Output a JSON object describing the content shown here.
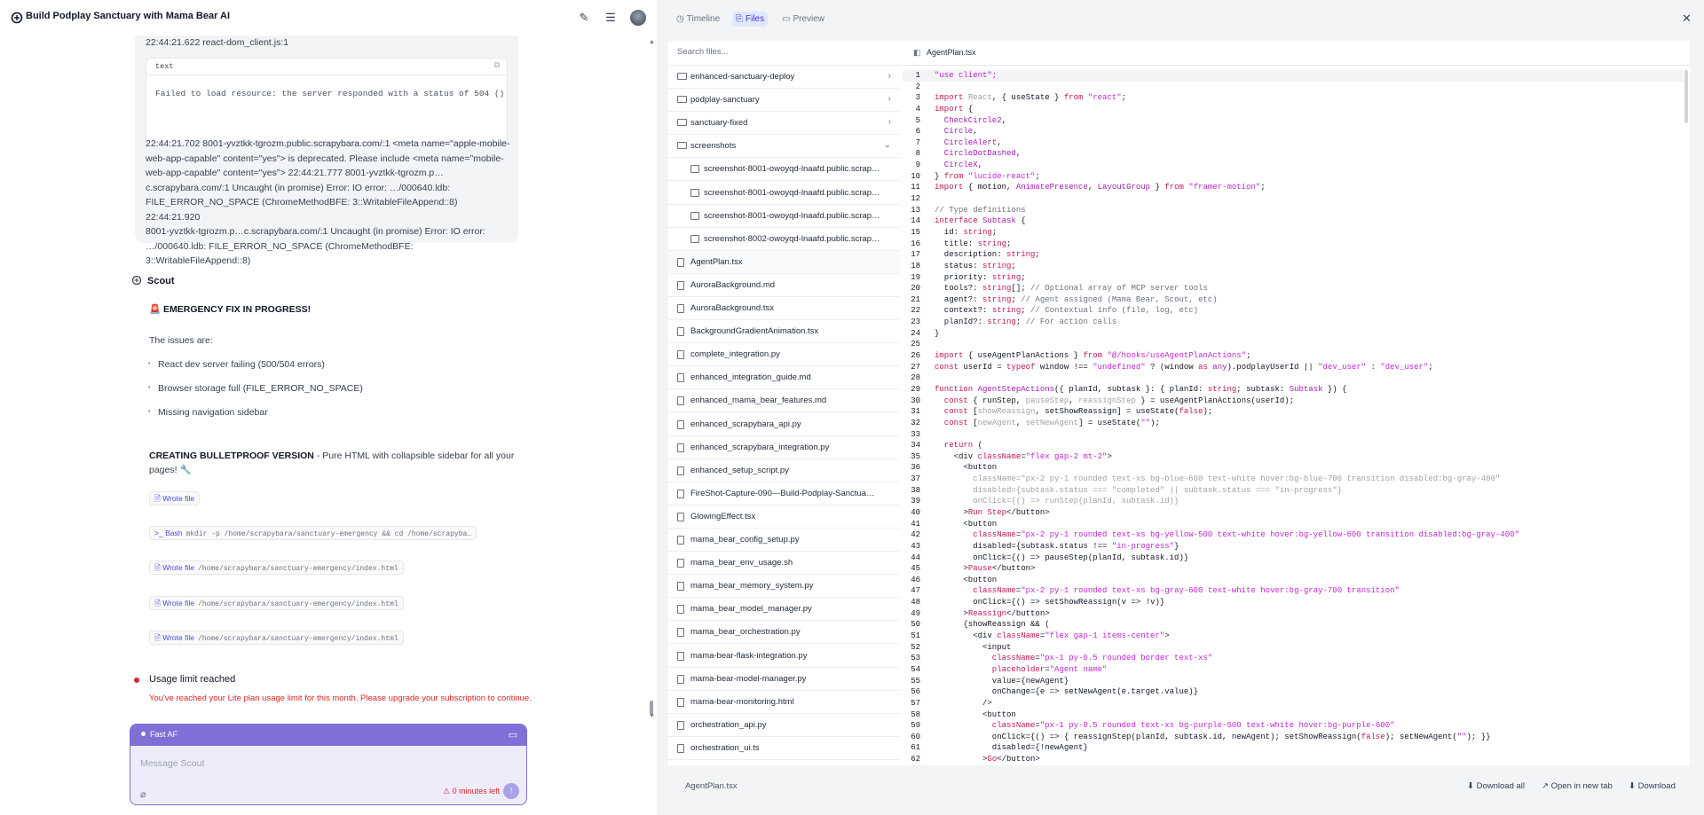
{
  "header": {
    "title": "Build Podplay Sanctuary with Mama Bear AI",
    "icons": [
      "edit-icon",
      "sidebar-list-icon",
      "avatar"
    ]
  },
  "chat": {
    "log_top": "22:44:21.622 react-dom_client.js:1",
    "code_block": {
      "lang": "text",
      "content": "Failed to load resource: the server responded with a status of 504 ()"
    },
    "log_lines": [
      "22:44:21.702 8001-yvztkk-tgrozm.public.scrapybara.com/:1 <meta name=\"apple-mobile-",
      "web-app-capable\" content=\"yes\"> is deprecated. Please include <meta name=\"mobile-",
      "web-app-capable\" content=\"yes\"> 22:44:21.777 8001-yvztkk-tgrozm.p…",
      "c.scrapybara.com/:1 Uncaught (in promise) Error: IO error: …/000640.ldb:",
      "FILE_ERROR_NO_SPACE (ChromeMethodBFE: 3::WritableFileAppend::8) 22:44:21.920",
      "8001-yvztkk-tgrozm.p…c.scrapybara.com/:1 Uncaught (in promise) Error: IO error:",
      "…/000640.ldb: FILE_ERROR_NO_SPACE (ChromeMethodBFE: 3::WritableFileAppend::8)"
    ],
    "agent_name": "Scout",
    "emergency": "🚨 EMERGENCY FIX IN PROGRESS!",
    "issues_intro": "The issues are:",
    "issues": [
      "React dev server failing (500/504 errors)",
      "Browser storage full (FILE_ERROR_NO_SPACE)",
      "Missing navigation sidebar"
    ],
    "plan_bold": "CREATING BULLETPROOF VERSION",
    "plan_rest": " - Pure HTML with collapsible sidebar for all your",
    "plan_line2": "pages! 🔧",
    "actions": [
      {
        "label": "Wrote file",
        "path": ""
      },
      {
        "label": "Bash",
        "path": "mkdir -p /home/scrapybara/sanctuary-emergency && cd /home/scrapyba…"
      },
      {
        "label": "Wrote file",
        "path": "/home/scrapybara/sanctuary-emergency/index.html"
      },
      {
        "label": "Wrote file",
        "path": "/home/scrapybara/sanctuary-emergency/index.html"
      },
      {
        "label": "Wrote file",
        "path": "/home/scrapybara/sanctuary-emergency/index.html"
      }
    ],
    "usage_title": "Usage limit reached",
    "usage_text": "You've reached your Lite plan usage limit for this month. Please upgrade your subscription to continue."
  },
  "composer": {
    "mode": "Fast AF",
    "placeholder": "Message Scout",
    "time_left": "⚠ 0 minutes left"
  },
  "panel": {
    "tabs": [
      {
        "label": "Timeline",
        "icon": "clock-icon",
        "active": false
      },
      {
        "label": "Files",
        "icon": "files-icon",
        "active": true
      },
      {
        "label": "Preview",
        "icon": "preview-icon",
        "active": false
      }
    ],
    "search_placeholder": "Search files...",
    "files": [
      {
        "name": "enhanced-sanctuary-deploy",
        "kind": "folder",
        "chev": "›"
      },
      {
        "name": "podplay-sanctuary",
        "kind": "folder",
        "chev": "›"
      },
      {
        "name": "sanctuary-fixed",
        "kind": "folder",
        "chev": "›"
      },
      {
        "name": "screenshots",
        "kind": "folder",
        "chev": "⌄"
      },
      {
        "name": "screenshot-8001-owoyqd-lnaafd.public.scrap…",
        "kind": "image",
        "sub": true
      },
      {
        "name": "screenshot-8001-owoyqd-lnaafd.public.scrap…",
        "kind": "image",
        "sub": true
      },
      {
        "name": "screenshot-8001-owoyqd-lnaafd.public.scrap…",
        "kind": "image",
        "sub": true
      },
      {
        "name": "screenshot-8002-owoyqd-lnaafd.public.scrap…",
        "kind": "image",
        "sub": true
      },
      {
        "name": "AgentPlan.tsx",
        "kind": "file",
        "selected": true
      },
      {
        "name": "AuroraBackground.md",
        "kind": "file"
      },
      {
        "name": "AuroraBackground.tsx",
        "kind": "file"
      },
      {
        "name": "BackgroundGradientAnimation.tsx",
        "kind": "file"
      },
      {
        "name": "complete_integration.py",
        "kind": "file"
      },
      {
        "name": "enhanced_integration_guide.md",
        "kind": "file"
      },
      {
        "name": "enhanced_mama_bear_features.md",
        "kind": "file"
      },
      {
        "name": "enhanced_scrapybara_api.py",
        "kind": "file"
      },
      {
        "name": "enhanced_scrapybara_integration.py",
        "kind": "file"
      },
      {
        "name": "enhanced_setup_script.py",
        "kind": "file"
      },
      {
        "name": "FireShot-Capture-090---Build-Podplay-Sanctua…",
        "kind": "file"
      },
      {
        "name": "GlowingEffect.tsx",
        "kind": "file"
      },
      {
        "name": "mama_bear_config_setup.py",
        "kind": "file"
      },
      {
        "name": "mama_bear_env_usage.sh",
        "kind": "file"
      },
      {
        "name": "mama_bear_memory_system.py",
        "kind": "file"
      },
      {
        "name": "mama_bear_model_manager.py",
        "kind": "file"
      },
      {
        "name": "mama_bear_orchestration.py",
        "kind": "file"
      },
      {
        "name": "mama-bear-flask-integration.py",
        "kind": "file"
      },
      {
        "name": "mama-bear-model-manager.py",
        "kind": "file"
      },
      {
        "name": "mama-bear-monitoring.html",
        "kind": "file"
      },
      {
        "name": "orchestration_api.py",
        "kind": "file"
      },
      {
        "name": "orchestration_ui.ts",
        "kind": "file"
      }
    ],
    "open_file": "AgentPlan.tsx",
    "footer": {
      "file": "AgentPlan.tsx",
      "download_all": "Download all",
      "open_new_tab": "Open in new tab",
      "download": "Download"
    }
  },
  "code_lines": [
    [
      1,
      [
        [
          "st",
          "\"use client\";"
        ]
      ]
    ],
    [
      2,
      []
    ],
    [
      3,
      [
        [
          "kw",
          "import "
        ],
        [
          "dim",
          "React"
        ],
        [
          "fn2",
          ", { useState } "
        ],
        [
          "kw",
          "from "
        ],
        [
          "st",
          "\"react\""
        ],
        [
          "fn2",
          ";"
        ]
      ]
    ],
    [
      4,
      [
        [
          "kw",
          "import "
        ],
        [
          "fn2",
          "{"
        ]
      ]
    ],
    [
      5,
      [
        [
          "tp",
          "  CheckCircle2"
        ],
        [
          "fn2",
          ","
        ]
      ]
    ],
    [
      6,
      [
        [
          "tp",
          "  Circle"
        ],
        [
          "fn2",
          ","
        ]
      ]
    ],
    [
      7,
      [
        [
          "tp",
          "  CircleAlert"
        ],
        [
          "fn2",
          ","
        ]
      ]
    ],
    [
      8,
      [
        [
          "tp",
          "  CircleDotDashed"
        ],
        [
          "fn2",
          ","
        ]
      ]
    ],
    [
      9,
      [
        [
          "tp",
          "  CircleX"
        ],
        [
          "fn2",
          ","
        ]
      ]
    ],
    [
      10,
      [
        [
          "fn2",
          "} "
        ],
        [
          "kw",
          "from "
        ],
        [
          "st",
          "\"lucide-react\""
        ],
        [
          "fn2",
          ";"
        ]
      ]
    ],
    [
      11,
      [
        [
          "kw",
          "import "
        ],
        [
          "fn2",
          "{ motion, "
        ],
        [
          "tp",
          "AnimatePresence"
        ],
        [
          "fn2",
          ", "
        ],
        [
          "tp",
          "LayoutGroup"
        ],
        [
          "fn2",
          " } "
        ],
        [
          "kw",
          "from "
        ],
        [
          "st",
          "\"framer-motion\""
        ],
        [
          "fn2",
          ";"
        ]
      ]
    ],
    [
      12,
      []
    ],
    [
      13,
      [
        [
          "cm",
          "// Type definitions"
        ]
      ]
    ],
    [
      14,
      [
        [
          "kw",
          "interface "
        ],
        [
          "tp",
          "Subtask "
        ],
        [
          "fn2",
          "{"
        ]
      ]
    ],
    [
      15,
      [
        [
          "fn2",
          "  id: "
        ],
        [
          "kw",
          "string"
        ],
        [
          "fn2",
          ";"
        ]
      ]
    ],
    [
      16,
      [
        [
          "fn2",
          "  title: "
        ],
        [
          "kw",
          "string"
        ],
        [
          "fn2",
          ";"
        ]
      ]
    ],
    [
      17,
      [
        [
          "fn2",
          "  description: "
        ],
        [
          "kw",
          "string"
        ],
        [
          "fn2",
          ";"
        ]
      ]
    ],
    [
      18,
      [
        [
          "fn2",
          "  status: "
        ],
        [
          "kw",
          "string"
        ],
        [
          "fn2",
          ";"
        ]
      ]
    ],
    [
      19,
      [
        [
          "fn2",
          "  priority: "
        ],
        [
          "kw",
          "string"
        ],
        [
          "fn2",
          ";"
        ]
      ]
    ],
    [
      20,
      [
        [
          "fn2",
          "  tools?: "
        ],
        [
          "kw",
          "string"
        ],
        [
          "fn2",
          "[]; "
        ],
        [
          "cm",
          "// Optional array of MCP server tools"
        ]
      ]
    ],
    [
      21,
      [
        [
          "fn2",
          "  agent?: "
        ],
        [
          "kw",
          "string"
        ],
        [
          "fn2",
          "; "
        ],
        [
          "cm",
          "// Agent assigned (Mama Bear, Scout, etc)"
        ]
      ]
    ],
    [
      22,
      [
        [
          "fn2",
          "  context?: "
        ],
        [
          "kw",
          "string"
        ],
        [
          "fn2",
          "; "
        ],
        [
          "cm",
          "// Contextual info (file, log, etc)"
        ]
      ]
    ],
    [
      23,
      [
        [
          "fn2",
          "  planId?: "
        ],
        [
          "kw",
          "string"
        ],
        [
          "fn2",
          "; "
        ],
        [
          "cm",
          "// For action calls"
        ]
      ]
    ],
    [
      24,
      [
        [
          "fn2",
          "}"
        ]
      ]
    ],
    [
      25,
      []
    ],
    [
      26,
      [
        [
          "kw",
          "import "
        ],
        [
          "fn2",
          "{ useAgentPlanActions } "
        ],
        [
          "kw",
          "from "
        ],
        [
          "st",
          "\"@/hooks/useAgentPlanActions\""
        ],
        [
          "fn2",
          ";"
        ]
      ]
    ],
    [
      27,
      [
        [
          "kw",
          "const "
        ],
        [
          "fn2",
          "userId = "
        ],
        [
          "kw",
          "typeof "
        ],
        [
          "fn2",
          "window !== "
        ],
        [
          "st",
          "\"undefined\""
        ],
        [
          "fn2",
          " ? (window "
        ],
        [
          "kw",
          "as "
        ],
        [
          "tp",
          "any"
        ],
        [
          "fn2",
          ").podplayUserId || "
        ],
        [
          "st",
          "\"dev_user\""
        ],
        [
          "fn2",
          " : "
        ],
        [
          "st",
          "\"dev_user\""
        ],
        [
          "fn2",
          ";"
        ]
      ]
    ],
    [
      28,
      []
    ],
    [
      29,
      [
        [
          "kw",
          "function "
        ],
        [
          "tp",
          "AgentStepActions"
        ],
        [
          "fn2",
          "({ planId, subtask }: { planId: "
        ],
        [
          "kw",
          "string"
        ],
        [
          "fn2",
          "; subtask: "
        ],
        [
          "tp",
          "Subtask"
        ],
        [
          "fn2",
          " }) {"
        ]
      ]
    ],
    [
      30,
      [
        [
          "kw",
          "  const "
        ],
        [
          "fn2",
          "{ runStep, "
        ],
        [
          "dim",
          "pauseStep"
        ],
        [
          "fn2",
          ", "
        ],
        [
          "dim",
          "reassignStep"
        ],
        [
          "fn2",
          " } = useAgentPlanActions(userId);"
        ]
      ]
    ],
    [
      31,
      [
        [
          "kw",
          "  const "
        ],
        [
          "fn2",
          "["
        ],
        [
          "dim",
          "showReassign"
        ],
        [
          "fn2",
          ", setShowReassign] = useState("
        ],
        [
          "kw",
          "false"
        ],
        [
          "fn2",
          ");"
        ]
      ]
    ],
    [
      32,
      [
        [
          "kw",
          "  const "
        ],
        [
          "fn2",
          "["
        ],
        [
          "dim",
          "newAgent"
        ],
        [
          "fn2",
          ", "
        ],
        [
          "dim",
          "setNewAgent"
        ],
        [
          "fn2",
          "] = useState("
        ],
        [
          "st",
          "\"\""
        ],
        [
          "fn2",
          ");"
        ]
      ]
    ],
    [
      33,
      []
    ],
    [
      34,
      [
        [
          "kw",
          "  return "
        ],
        [
          "fn2",
          "("
        ]
      ]
    ],
    [
      35,
      [
        [
          "fn2",
          "    <div "
        ],
        [
          "kw",
          "className"
        ],
        [
          "fn2",
          "="
        ],
        [
          "st",
          "\"flex gap-2 mt-2\""
        ],
        [
          "fn2",
          ">"
        ]
      ]
    ],
    [
      36,
      [
        [
          "fn2",
          "      <button"
        ]
      ]
    ],
    [
      37,
      [
        [
          "dim",
          "        className=\"px-2 py-1 rounded text-xs bg-blue-600 text-white hover:bg-blue-700 transition disabled:bg-gray-400\""
        ]
      ]
    ],
    [
      38,
      [
        [
          "dim",
          "        disabled={subtask.status === \"completed\" || subtask.status === \"in-progress\"}"
        ]
      ]
    ],
    [
      39,
      [
        [
          "dim",
          "        onClick={() => runStep(planId, subtask.id)}"
        ]
      ]
    ],
    [
      40,
      [
        [
          "fn2",
          "      >"
        ],
        [
          "kw",
          "Run Step"
        ],
        [
          "fn2",
          "</button>"
        ]
      ]
    ],
    [
      41,
      [
        [
          "fn2",
          "      <button"
        ]
      ]
    ],
    [
      42,
      [
        [
          "kw",
          "        className"
        ],
        [
          "fn2",
          "="
        ],
        [
          "st",
          "\"px-2 py-1 rounded text-xs bg-yellow-500 text-white hover:bg-yellow-600 transition disabled:bg-gray-400\""
        ]
      ]
    ],
    [
      43,
      [
        [
          "fn2",
          "        disabled={subtask.status !== "
        ],
        [
          "st",
          "\"in-progress\""
        ],
        [
          "fn2",
          "}"
        ]
      ]
    ],
    [
      44,
      [
        [
          "fn2",
          "        onClick={() => pauseStep(planId, subtask.id)}"
        ]
      ]
    ],
    [
      45,
      [
        [
          "fn2",
          "      >"
        ],
        [
          "kw",
          "Pause"
        ],
        [
          "fn2",
          "</button>"
        ]
      ]
    ],
    [
      46,
      [
        [
          "fn2",
          "      <button"
        ]
      ]
    ],
    [
      47,
      [
        [
          "kw",
          "        className"
        ],
        [
          "fn2",
          "="
        ],
        [
          "st",
          "\"px-2 py-1 rounded text-xs bg-gray-600 text-white hover:bg-gray-700 transition\""
        ]
      ]
    ],
    [
      48,
      [
        [
          "fn2",
          "        onClick={() => setShowReassign(v => !v)}"
        ]
      ]
    ],
    [
      49,
      [
        [
          "fn2",
          "      >"
        ],
        [
          "kw",
          "Reassign"
        ],
        [
          "fn2",
          "</button>"
        ]
      ]
    ],
    [
      50,
      [
        [
          "fn2",
          "      {showReassign && ("
        ]
      ]
    ],
    [
      51,
      [
        [
          "fn2",
          "        <div "
        ],
        [
          "kw",
          "className"
        ],
        [
          "fn2",
          "="
        ],
        [
          "st",
          "\"flex gap-1 items-center\""
        ],
        [
          "fn2",
          ">"
        ]
      ]
    ],
    [
      52,
      [
        [
          "fn2",
          "          <input"
        ]
      ]
    ],
    [
      53,
      [
        [
          "kw",
          "            className"
        ],
        [
          "fn2",
          "="
        ],
        [
          "st",
          "\"px-1 py-0.5 rounded border text-xs\""
        ]
      ]
    ],
    [
      54,
      [
        [
          "kw",
          "            placeholder"
        ],
        [
          "fn2",
          "="
        ],
        [
          "st",
          "\"Agent name\""
        ]
      ]
    ],
    [
      55,
      [
        [
          "fn2",
          "            value={newAgent}"
        ]
      ]
    ],
    [
      56,
      [
        [
          "fn2",
          "            onChange={e => setNewAgent(e.target.value)}"
        ]
      ]
    ],
    [
      57,
      [
        [
          "fn2",
          "          />"
        ]
      ]
    ],
    [
      58,
      [
        [
          "fn2",
          "          <button"
        ]
      ]
    ],
    [
      59,
      [
        [
          "kw",
          "            className"
        ],
        [
          "fn2",
          "="
        ],
        [
          "st",
          "\"px-1 py-0.5 rounded text-xs bg-purple-500 text-white hover:bg-purple-600\""
        ]
      ]
    ],
    [
      60,
      [
        [
          "fn2",
          "            onClick={() => { reassignStep(planId, subtask.id, newAgent); setShowReassign("
        ],
        [
          "kw",
          "false"
        ],
        [
          "fn2",
          "); setNewAgent("
        ],
        [
          "st",
          "\"\""
        ],
        [
          "fn2",
          "); }}"
        ]
      ]
    ],
    [
      61,
      [
        [
          "fn2",
          "            disabled={!newAgent}"
        ]
      ]
    ],
    [
      62,
      [
        [
          "fn2",
          "          >"
        ],
        [
          "kw",
          "Go"
        ],
        [
          "fn2",
          "</button>"
        ]
      ]
    ]
  ]
}
